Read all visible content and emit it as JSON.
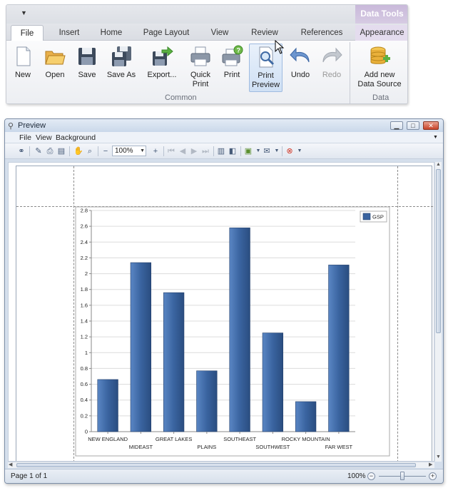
{
  "ribbon": {
    "context_header": "Data Tools",
    "tabs": [
      "File",
      "Insert",
      "Home",
      "Page Layout",
      "View",
      "Review",
      "References",
      "Appearance"
    ],
    "buttons": [
      {
        "label": "New",
        "icon": "new-document-icon",
        "disabled": false
      },
      {
        "label": "Open",
        "icon": "open-folder-icon",
        "disabled": false
      },
      {
        "label": "Save",
        "icon": "save-disk-icon",
        "disabled": false
      },
      {
        "label": "Save As",
        "icon": "save-as-disk-icon",
        "disabled": false
      },
      {
        "label": "Export...",
        "icon": "export-icon",
        "disabled": false
      },
      {
        "label": "Quick\nPrint",
        "icon": "quick-print-icon",
        "disabled": false
      },
      {
        "label": "Print",
        "icon": "print-icon",
        "disabled": false
      },
      {
        "label": "Print\nPreview",
        "icon": "print-preview-icon",
        "disabled": false,
        "active": true
      },
      {
        "label": "Undo",
        "icon": "undo-icon",
        "disabled": false
      },
      {
        "label": "Redo",
        "icon": "redo-icon",
        "disabled": true
      },
      {
        "label": "Add new\nData Source",
        "icon": "database-add-icon",
        "disabled": false
      }
    ],
    "groups": {
      "common": "Common",
      "data": "Data"
    }
  },
  "preview": {
    "title": "Preview",
    "menu": [
      "File",
      "View",
      "Background"
    ],
    "zoom_value": "100%",
    "status_page": "Page 1 of 1",
    "status_zoom": "100%",
    "zoom_level": 0.5
  },
  "chart_data": {
    "type": "bar",
    "categories": [
      "NEW ENGLAND",
      "MIDEAST",
      "GREAT LAKES",
      "PLAINS",
      "SOUTHEAST",
      "SOUTHWEST",
      "ROCKY MOUNTAIN",
      "FAR WEST"
    ],
    "series": [
      {
        "name": "GSP",
        "values": [
          0.66,
          2.14,
          1.76,
          0.77,
          2.58,
          1.25,
          0.38,
          2.11
        ],
        "color": "#3a64a0"
      }
    ],
    "ylim": [
      0,
      2.8
    ],
    "yticks": [
      0,
      0.2,
      0.4,
      0.6,
      0.8,
      1,
      1.2,
      1.4,
      1.6,
      1.8,
      2,
      2.2,
      2.4,
      2.6,
      2.8
    ],
    "grid": true,
    "legend": "top-right"
  }
}
